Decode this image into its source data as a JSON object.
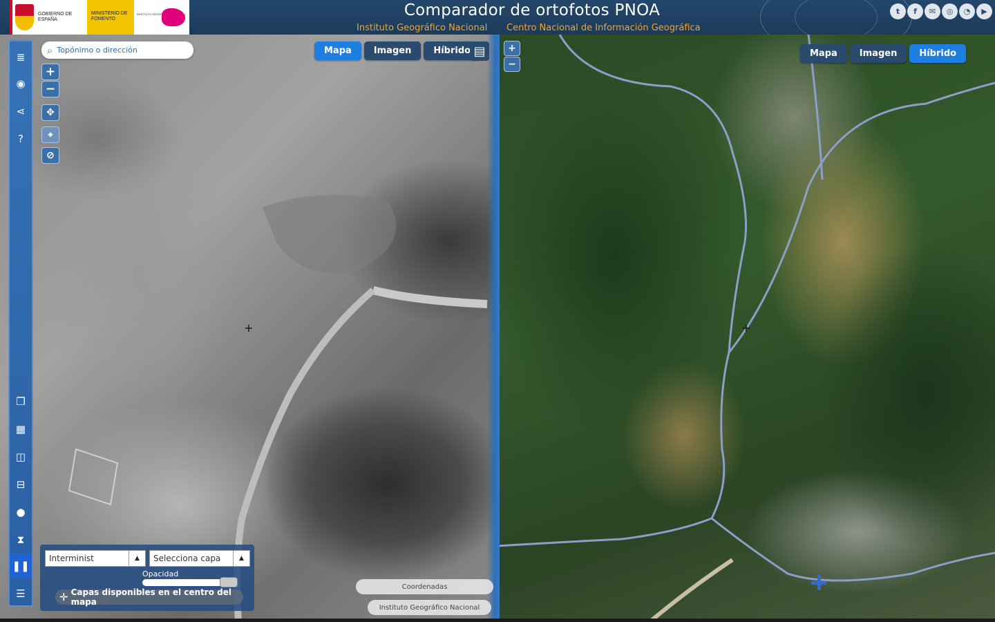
{
  "header": {
    "title": "Comparador de ortofotos PNOA",
    "institute_1": "Instituto Geográfico Nacional",
    "institute_2": "Centro Nacional de Información Geográfica",
    "logo_gov_text": "GOBIERNO DE ESPAÑA",
    "logo_ministry_text": "MINISTERIO DE FOMENTO",
    "logo_ign_text": "INSTITUTO GEOGRÁFICO NACIONAL",
    "social": [
      {
        "name": "twitter-icon",
        "glyph": "t"
      },
      {
        "name": "facebook-icon",
        "glyph": "f"
      },
      {
        "name": "mail-icon",
        "glyph": "✉"
      },
      {
        "name": "instagram-icon",
        "glyph": "◎"
      },
      {
        "name": "rss-icon",
        "glyph": "◔"
      },
      {
        "name": "youtube-icon",
        "glyph": "▶"
      }
    ]
  },
  "search": {
    "placeholder": "Topónimo o dirección"
  },
  "left_map": {
    "basemap": {
      "map_label": "Mapa",
      "image_label": "Imagen",
      "hybrid_label": "Híbrido",
      "active": "Mapa"
    },
    "layer_select_1": "Interminist",
    "layer_select_2": "Selecciona capa",
    "opacity_label": "Opacidad",
    "opacity_value": 0.9,
    "available_layers_label": "Capas disponibles en el centro del mapa",
    "coords_label": "Coordenadas",
    "attribution": "Instituto Geográfico Nacional"
  },
  "right_map": {
    "basemap": {
      "map_label": "Mapa",
      "image_label": "Imagen",
      "hybrid_label": "Híbrido",
      "active": "Híbrido"
    }
  },
  "colors": {
    "header_bg": "#1c3b5a",
    "accent_orange": "#f0a531",
    "active_blue": "#1f7fe0",
    "toolbar_blue": "#3672b6"
  }
}
